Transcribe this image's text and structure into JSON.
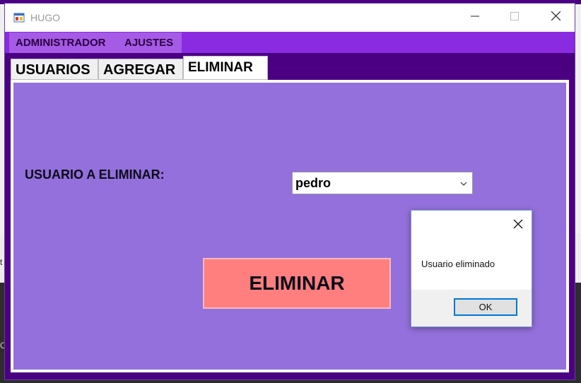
{
  "window": {
    "title": "HUGO"
  },
  "background": {
    "edge_glyph_1": "t",
    "edge_glyph_2": "C"
  },
  "menu": {
    "items": [
      {
        "label": "ADMINISTRADOR"
      },
      {
        "label": "AJUSTES"
      }
    ]
  },
  "tabs": [
    {
      "label": "USUARIOS",
      "active": false
    },
    {
      "label": "AGREGAR",
      "active": false
    },
    {
      "label": "ELIMINAR",
      "active": true
    }
  ],
  "form": {
    "user_label": "USUARIO A ELIMINAR:",
    "user_select_value": "pedro",
    "delete_button_label": "ELIMINAR"
  },
  "dialog": {
    "message": "Usuario eliminado",
    "ok_label": "OK"
  },
  "colors": {
    "window_background": "#4b0082",
    "menubar": "#8a2be2",
    "panel": "#9370db",
    "delete_button": "#ff7f7f",
    "dialog_focus_border": "#0078d7"
  },
  "icons": {
    "app": "app-window-icon",
    "minimize": "minimize-icon",
    "maximize": "maximize-icon",
    "close": "close-icon",
    "dropdown": "chevron-down-icon",
    "dialog_close": "close-icon"
  }
}
